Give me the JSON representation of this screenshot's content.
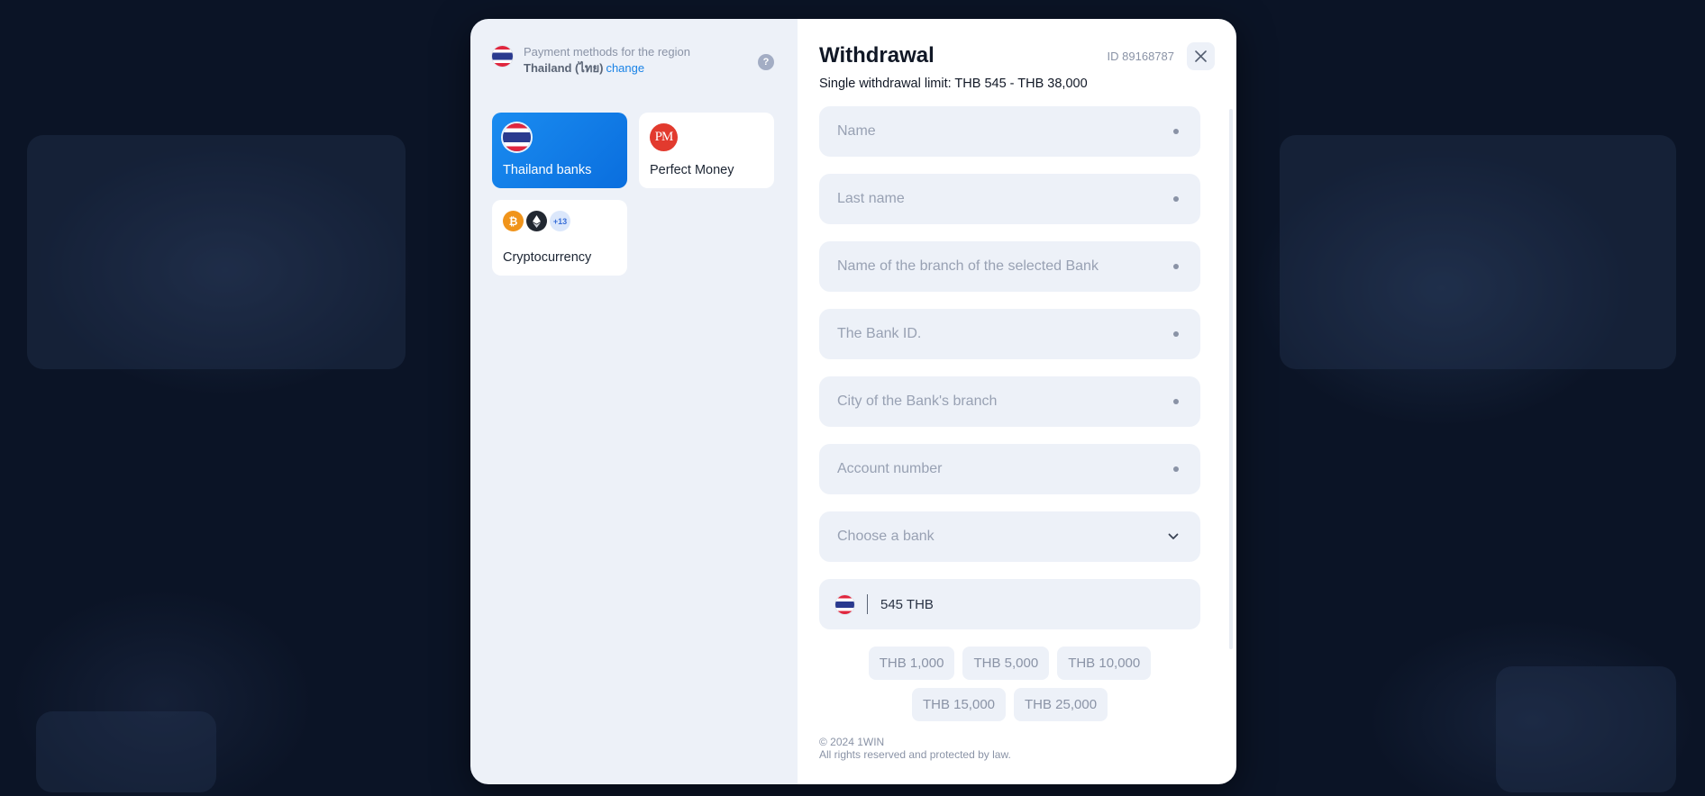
{
  "region": {
    "caption": "Payment methods for the region",
    "name": "Thailand (ไทย)",
    "change_link": "change",
    "help_icon": "?"
  },
  "methods": [
    {
      "label": "Thailand banks",
      "icon": "thailand-flag-icon",
      "active": true
    },
    {
      "label": "Perfect Money",
      "icon": "perfect-money-icon",
      "icon_text": "PM"
    },
    {
      "label": "Cryptocurrency",
      "icons": [
        "bitcoin-icon",
        "ethereum-icon"
      ],
      "more_badge": "+13"
    }
  ],
  "withdrawal": {
    "title": "Withdrawal",
    "user_id": "ID 89168787",
    "limit_text": "Single withdrawal limit: THB 545 - THB 38,000",
    "fields": [
      {
        "placeholder": "Name",
        "required": true
      },
      {
        "placeholder": "Last name",
        "required": true
      },
      {
        "placeholder": "Name of the branch of the selected Bank",
        "required": true
      },
      {
        "placeholder": "The Bank ID.",
        "required": true
      },
      {
        "placeholder": "City of the Bank's branch",
        "required": true
      },
      {
        "placeholder": "Account number",
        "required": true
      }
    ],
    "bank_select": {
      "placeholder": "Choose a bank"
    },
    "amount": {
      "value": "545 THB"
    },
    "presets": [
      "THB 1,000",
      "THB 5,000",
      "THB 10,000",
      "THB 15,000",
      "THB 25,000"
    ]
  },
  "footer": {
    "copyright": "© 2024 1WIN",
    "rights": "All rights reserved and protected by law."
  },
  "colors": {
    "accent": "#1a83e6",
    "active_method": "#0a6ede",
    "field_bg": "#edf1f8",
    "backdrop": "#0b1426"
  }
}
